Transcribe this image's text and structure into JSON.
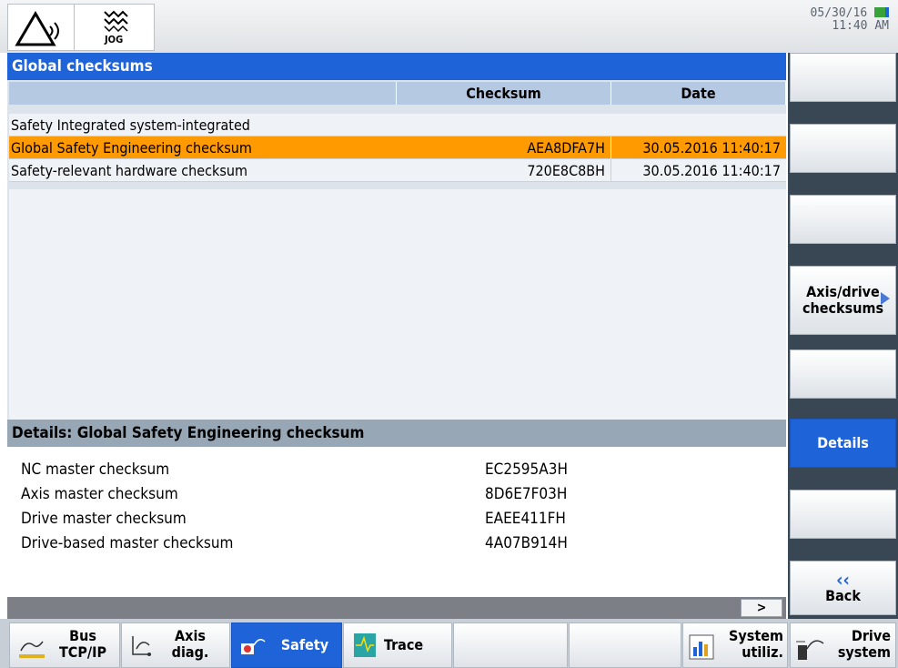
{
  "header": {
    "mode_label": "JOG",
    "date": "05/30/16",
    "time": "11:40 AM"
  },
  "panel": {
    "title": "Global checksums",
    "columns": [
      "",
      "Checksum",
      "Date"
    ],
    "group_label": "Safety Integrated system-integrated",
    "rows": [
      {
        "name": "Global Safety Engineering checksum",
        "checksum": "AEA8DFA7H",
        "date": "30.05.2016 11:40:17"
      },
      {
        "name": "Safety-relevant hardware checksum",
        "checksum": "720E8C8BH",
        "date": "30.05.2016 11:40:17"
      }
    ],
    "selected_row": 0
  },
  "details": {
    "title": "Details: Global Safety Engineering checksum",
    "items": [
      {
        "label": "NC master checksum",
        "value": "EC2595A3H"
      },
      {
        "label": "Axis master checksum",
        "value": "8D6E7F03H"
      },
      {
        "label": "Drive master checksum",
        "value": "EAEE411FH"
      },
      {
        "label": "Drive-based master checksum",
        "value": "4A07B914H"
      }
    ]
  },
  "scroll_right_label": ">",
  "vertical_softkeys": [
    {
      "label": ""
    },
    {
      "label": ""
    },
    {
      "label": ""
    },
    {
      "line1": "Axis/drive",
      "line2": "checksums"
    },
    {
      "label": ""
    },
    {
      "label": "Details",
      "active": true
    },
    {
      "label": ""
    },
    {
      "arrow": "‹‹",
      "label": "Back"
    }
  ],
  "horizontal_softkeys": [
    {
      "line1": "Bus",
      "line2": "TCP/IP",
      "icon": "bus-network-icon"
    },
    {
      "line1": "Axis",
      "line2": "diag.",
      "icon": "axis-diagnostics-icon"
    },
    {
      "label": "Safety",
      "icon": "safety-icon",
      "active": true
    },
    {
      "label": "Trace",
      "icon": "trace-icon"
    },
    {
      "label": ""
    },
    {
      "label": ""
    },
    {
      "line1": "System",
      "line2": "utiliz.",
      "icon": "system-utilization-icon"
    },
    {
      "line1": "Drive",
      "line2": "system",
      "icon": "drive-system-icon"
    }
  ],
  "colors": {
    "title_bar": "#1f63d8",
    "selection": "#ff9a00",
    "details_bar": "#98a7b6",
    "softkey_bar": "#394755"
  }
}
